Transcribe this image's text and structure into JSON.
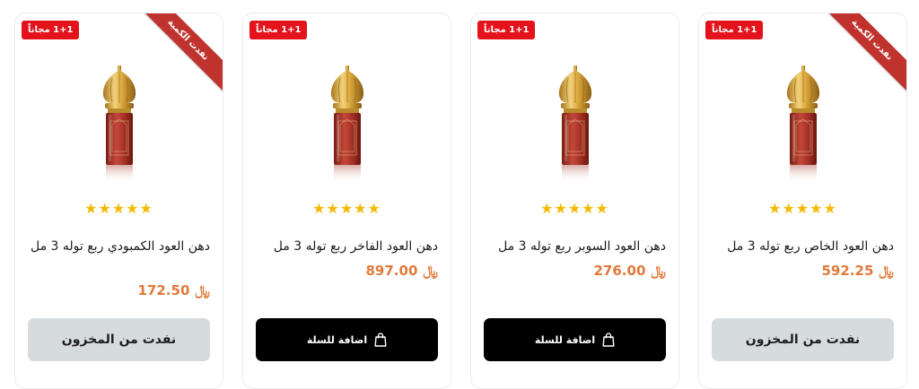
{
  "colors": {
    "badge": "#e4121b",
    "ribbon": "#c0322d",
    "price": "#e07a3b",
    "star": "#f5b800",
    "add_button": "#000000",
    "sold_out_button": "#d6dbde"
  },
  "products": [
    {
      "badge": "1+1 مجاناً",
      "ribbon": "نفدت الكمية",
      "rating": "★★★★★",
      "stars": 5,
      "title": "دهن العود الخاص ربع توله 3 مل",
      "price": "592.25",
      "currency": "﷼",
      "button": "نفدت من المخزون",
      "button_icon": "",
      "available": false
    },
    {
      "badge": "1+1 مجاناً",
      "ribbon": "",
      "rating": "★★★★★",
      "stars": 5,
      "title": "دهن العود السوبر ربع توله 3 مل",
      "price": "276.00",
      "currency": "﷼",
      "button": "اضافة للسلة",
      "button_icon": "shopping-bag-icon",
      "available": true
    },
    {
      "badge": "1+1 مجاناً",
      "ribbon": "",
      "rating": "★★★★★",
      "stars": 5,
      "title": "دهن العود الفاخر ربع توله 3 مل",
      "price": "897.00",
      "currency": "﷼",
      "button": "اضافة للسلة",
      "button_icon": "shopping-bag-icon",
      "available": true
    },
    {
      "badge": "1+1 مجاناً",
      "ribbon": "نفدت الكمية",
      "rating": "★★★★★",
      "stars": 5,
      "title": "دهن العود الكمبودي ربع توله 3 مل",
      "price": "172.50",
      "currency": "﷼",
      "button": "نفدت من المخزون",
      "button_icon": "",
      "available": false
    }
  ]
}
